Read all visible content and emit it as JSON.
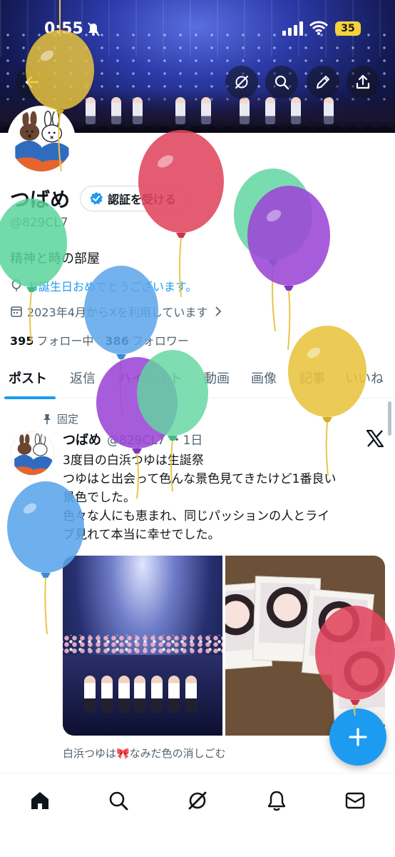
{
  "status_bar": {
    "time": "0:55",
    "battery": "35"
  },
  "profile": {
    "name": "つばめ",
    "verify_label": "認証を受ける",
    "handle": "@829CL7",
    "bio": "精神と時の部屋",
    "birthday_text": "お誕生日おめでとうございます。",
    "joined_text": "2023年4月からXを利用しています",
    "following_count": "395",
    "following_label": "フォロー中",
    "followers_count": "386",
    "followers_label": "フォロワー"
  },
  "tabs": [
    {
      "label": "ポスト",
      "active": true
    },
    {
      "label": "返信"
    },
    {
      "label": "ハイライト"
    },
    {
      "label": "動画"
    },
    {
      "label": "画像"
    },
    {
      "label": "記事"
    },
    {
      "label": "いいね"
    }
  ],
  "post": {
    "pinned_label": "固定",
    "author_name": "つばめ",
    "author_handle": "@829CL7",
    "time": "・1日",
    "lines": [
      "3度目の白浜つゆは生誕祭",
      "つゆはと出会って色んな景色見てきたけど1番良い",
      "景色でした。",
      "色々な人にも恵まれ、同じパッションの人とライ",
      "ブ見れて本当に幸せでした。"
    ],
    "media_caption": "白浜つゆは🎀なみだ色の消しごむ"
  },
  "icons": {
    "back": "back-arrow-icon",
    "grok": "grok-icon",
    "search": "search-icon",
    "edit": "pencil-icon",
    "share": "share-icon",
    "home": "home-icon",
    "notifications": "bell-icon",
    "messages": "mail-icon",
    "compose": "plus-icon"
  },
  "colors": {
    "accent": "#1d9bf0",
    "text": "#0f1419",
    "secondary": "#536471",
    "battery": "#f5d23c"
  }
}
